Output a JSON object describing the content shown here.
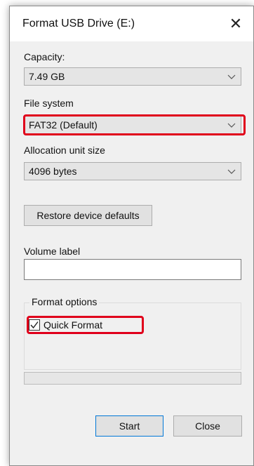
{
  "window": {
    "title": "Format USB Drive (E:)",
    "close_glyph": "✕"
  },
  "capacity": {
    "label": "Capacity:",
    "value": "7.49 GB"
  },
  "file_system": {
    "label": "File system",
    "value": "FAT32 (Default)"
  },
  "allocation": {
    "label": "Allocation unit size",
    "value": "4096 bytes"
  },
  "restore_button": "Restore device defaults",
  "volume": {
    "label": "Volume label",
    "value": ""
  },
  "format_options": {
    "legend": "Format options",
    "quick_format_label": "Quick Format",
    "quick_format_checked": true
  },
  "progress": {
    "fraction": 0
  },
  "buttons": {
    "start": "Start",
    "close": "Close"
  },
  "colors": {
    "highlight": "#e0001b",
    "start_border": "#0078d7",
    "progress_fill": "#06b025"
  },
  "icons": {
    "dropdown": "chevron-down-icon",
    "checkbox": "checkmark-icon",
    "close": "close-icon"
  }
}
